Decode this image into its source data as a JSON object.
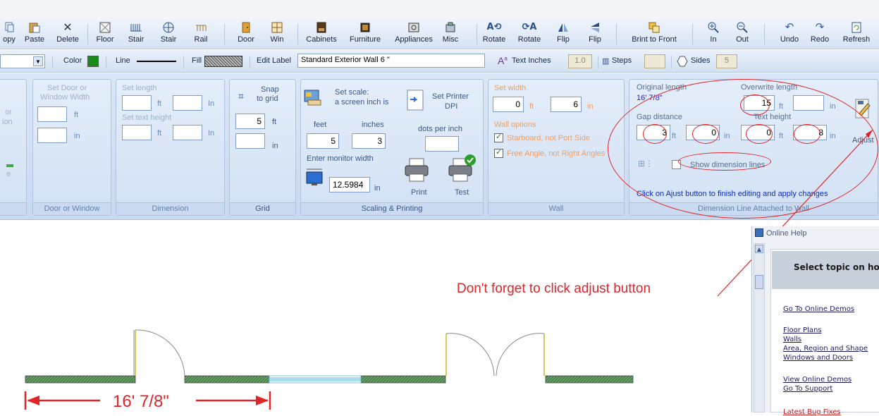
{
  "toolbar": {
    "buttons": [
      {
        "id": "copy",
        "label": "opy",
        "icon": "copy-icon"
      },
      {
        "id": "paste",
        "label": "Paste",
        "icon": "paste-icon"
      },
      {
        "id": "delete",
        "label": "Delete",
        "icon": "delete-icon"
      },
      {
        "id": "floor",
        "label": "Floor",
        "icon": "floor-icon"
      },
      {
        "id": "stair1",
        "label": "Stair",
        "icon": "stair-icon"
      },
      {
        "id": "stair2",
        "label": "Stair",
        "icon": "spiral-stair-icon"
      },
      {
        "id": "rail",
        "label": "Rail",
        "icon": "rail-icon"
      },
      {
        "id": "door",
        "label": "Door",
        "icon": "door-icon"
      },
      {
        "id": "win",
        "label": "Win",
        "icon": "window-icon"
      },
      {
        "id": "cabinets",
        "label": "Cabinets",
        "icon": "cabinets-icon"
      },
      {
        "id": "furniture",
        "label": "Furniture",
        "icon": "furniture-icon"
      },
      {
        "id": "appliances",
        "label": "Appliances",
        "icon": "appliances-icon"
      },
      {
        "id": "misc",
        "label": "Misc",
        "icon": "misc-icon"
      },
      {
        "id": "rotate1",
        "label": "Rotate",
        "icon": "rotate-left-icon"
      },
      {
        "id": "rotate2",
        "label": "Rotate",
        "icon": "rotate-right-icon"
      },
      {
        "id": "flip1",
        "label": "Flip",
        "icon": "flip-horizontal-icon"
      },
      {
        "id": "flip2",
        "label": "Flip",
        "icon": "flip-vertical-icon"
      },
      {
        "id": "brint",
        "label": "Brint to Front",
        "icon": "bring-front-icon"
      },
      {
        "id": "zoomin",
        "label": "In",
        "icon": "zoom-in-icon"
      },
      {
        "id": "zoomout",
        "label": "Out",
        "icon": "zoom-out-icon"
      },
      {
        "id": "undo",
        "label": "Undo",
        "icon": "undo-icon"
      },
      {
        "id": "redo",
        "label": "Redo",
        "icon": "redo-icon"
      },
      {
        "id": "refresh",
        "label": "Refresh",
        "icon": "refresh-icon"
      }
    ]
  },
  "propbar": {
    "color_label": "Color",
    "color_value": "#1a8a1a",
    "line_label": "Line",
    "fill_label": "Fill",
    "edit_label": "Edit Label",
    "label_value": "Standard Exterior Wall 6 \"",
    "text_inches_label": "Text Inches",
    "text_inches_value": "1.0",
    "steps_label": "Steps",
    "sides_label": "Sides",
    "sides_value": "5"
  },
  "ribbon": {
    "partial": {
      "line1": "or",
      "line2": "ion",
      "line3": "e"
    },
    "door_window": {
      "header_line1": "Set Door or",
      "header_line2": "Window Width",
      "ft": "ft",
      "in": "in",
      "title": "Door or Window"
    },
    "dimension": {
      "set_length": "Set length",
      "set_text_height": "Set text height",
      "ft": "ft",
      "in": "In",
      "title": "Dimension"
    },
    "grid": {
      "snap_line1": "Snap",
      "snap_line2": "to grid",
      "value_ft": "5",
      "ft": "ft",
      "in": "in",
      "title": "Grid"
    },
    "scaling": {
      "set_scale_line1": "Set scale:",
      "set_scale_line2": "a screen inch is",
      "feet_label": "feet",
      "inches_label": "inches",
      "feet_value": "5",
      "inches_value": "3",
      "set_printer_line1": "Set Printer",
      "set_printer_line2": "DPI",
      "dots_per_inch": "dots per inch",
      "enter_monitor_width": "Enter monitor width",
      "monitor_width": "12.5984",
      "in": "in",
      "print": "Print",
      "test": "Test",
      "title": "Scaling & Printing"
    },
    "wall": {
      "set_width": "Set width",
      "ft_value": "0",
      "in_value": "6",
      "ft": "ft",
      "in": "in",
      "wall_options": "Wall options",
      "option1": "Starboard, not Port Side",
      "option2": "Free Angle, not Right Angles",
      "title": "Wall"
    },
    "dimline": {
      "original_length": "Original length",
      "original_value": "16' 7/8\"",
      "overwrite_length": "Overwrite length",
      "overwrite_ft": "15",
      "ft": "ft",
      "in": "in",
      "gap_distance": "Gap distance",
      "gap_ft": "3",
      "gap_in": "0",
      "text_height": "Text height",
      "th_ft": "0",
      "th_in": "8",
      "show_dimension_lines": "Show dimension lines",
      "adjust": "Adjust",
      "hint": "Click on Ajust button to finish editing and apply changes",
      "title": "Dimension Line Attached to Wall"
    }
  },
  "annotation": {
    "callout": "Don't forget to click adjust button"
  },
  "canvas": {
    "dimension_text": "16' 7/8\""
  },
  "help": {
    "title": "Online Help",
    "select_topic": "Select topic on how",
    "links": [
      "Go To Online Demos",
      "Floor Plans",
      "Walls",
      "Area, Region and Shape",
      "Windows and Doors",
      "View Online Demos",
      "Go To Support",
      "Latest Bug Fixes"
    ]
  },
  "colors": {
    "annotation_red": "#e0242a",
    "wall_green": "#3c6e3c",
    "hint_blue": "#0c2dbb"
  }
}
